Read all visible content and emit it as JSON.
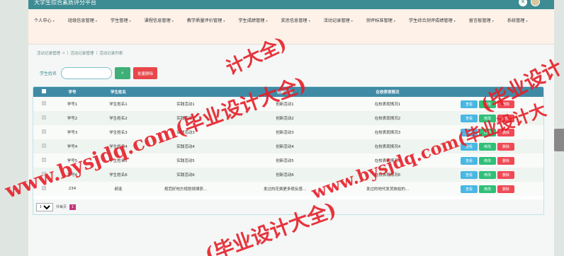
{
  "app": {
    "title": "大学生综合素质评分平台"
  },
  "nav": {
    "items": [
      {
        "label": "个人中心"
      },
      {
        "label": "班级信息管理"
      },
      {
        "label": "学生管理"
      },
      {
        "label": "课程信息管理"
      },
      {
        "label": "教学质量评价管理"
      },
      {
        "label": "学生成绩管理"
      },
      {
        "label": "奖惩信息管理"
      },
      {
        "label": "活动记录管理"
      },
      {
        "label": "测评标准管理"
      },
      {
        "label": "学生综合测评成绩管理"
      },
      {
        "label": "留言板管理"
      },
      {
        "label": "系统管理"
      }
    ]
  },
  "breadcrumb": {
    "root": "活动记录管理",
    "mid": "活动记录管理",
    "current": "活动记录列表"
  },
  "search": {
    "label": "学生姓名",
    "value": "",
    "placeholder": "",
    "batch_delete_label": "批量删除"
  },
  "table": {
    "columns": [
      "学号",
      "学生姓名",
      "创新活动",
      "在校表现情况",
      ""
    ],
    "rows": [
      {
        "id": "学号1",
        "name": "学生姓名1",
        "practice": "实践活动1",
        "innovation": "创新活动1",
        "performance": "在校表现情况1"
      },
      {
        "id": "学号2",
        "name": "学生姓名2",
        "practice": "实践活动2",
        "innovation": "创新活动2",
        "performance": "在校表现情况2"
      },
      {
        "id": "学号3",
        "name": "学生姓名3",
        "practice": "实践活动3",
        "innovation": "创新活动3",
        "performance": "在校表现情况3"
      },
      {
        "id": "学号4",
        "name": "学生姓名4",
        "practice": "实践活动4",
        "innovation": "创新活动4",
        "performance": "在校表现情况4"
      },
      {
        "id": "学号5",
        "name": "学生姓名5",
        "practice": "实践活动5",
        "innovation": "创新活动5",
        "performance": "在校表现情况5"
      },
      {
        "id": "学号6",
        "name": "学生姓名6",
        "practice": "实践活动6",
        "innovation": "创新活动6",
        "performance": "在校表现情况6"
      },
      {
        "id": "234",
        "name": "郝连",
        "practice": "规范好地方规划规律获...",
        "innovation": "发过的花费更多很反感...",
        "performance": "发过的地代发货放给的..."
      }
    ],
    "actions": {
      "view": "查看",
      "edit": "修改",
      "delete": "删除"
    }
  },
  "pager": {
    "page_size": "10",
    "info": "共每页",
    "current_page": "1"
  },
  "watermark": {
    "text1": "www.bysjdq.com(毕业设计大全)",
    "text2": "www.bysjdq.com(毕业设计大",
    "text3": "(毕业设计大全)",
    "text4": "(毕业设计",
    "text5": "计大全)"
  },
  "colors": {
    "header": "#3d8b93",
    "nav_bg": "#fdf1e8",
    "table_head": "#3f8ba6",
    "view": "#48b7e3",
    "edit": "#2fbf78",
    "delete": "#ef4a55"
  }
}
